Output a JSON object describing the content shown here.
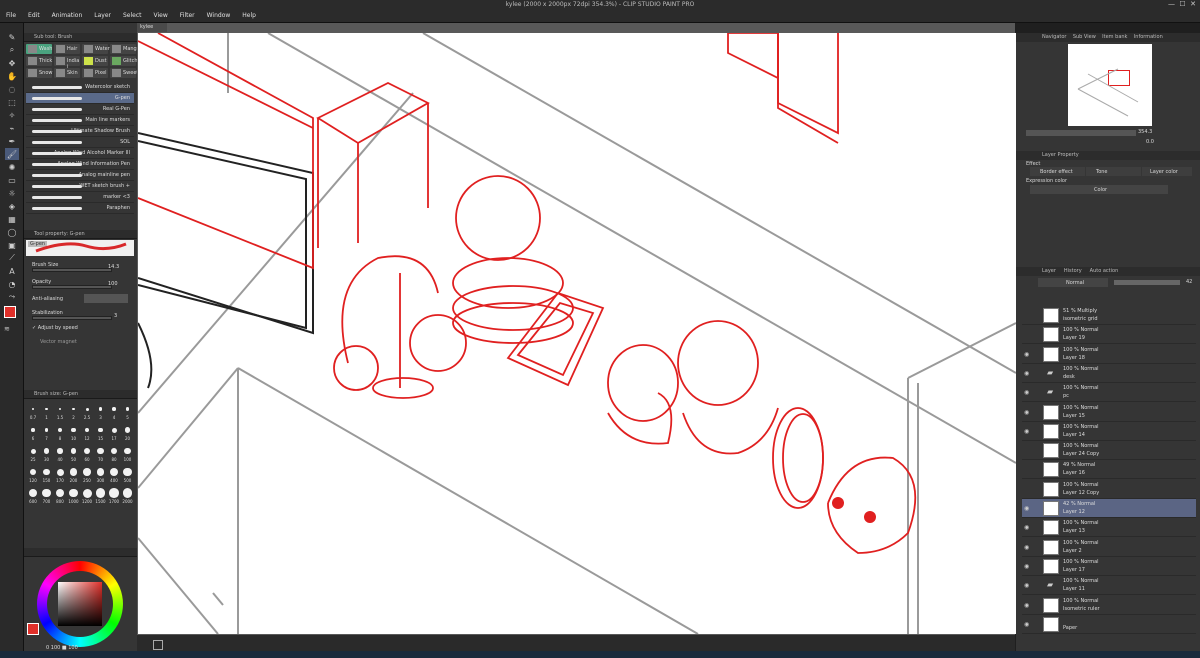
{
  "window": {
    "title": "kylee (2000 x 2000px 72dpi 354.3%) - CLIP STUDIO PAINT PRO"
  },
  "menu": [
    "File",
    "Edit",
    "Animation",
    "Layer",
    "Select",
    "View",
    "Filter",
    "Window",
    "Help"
  ],
  "canvas_tab": "kylee",
  "sub_tool": {
    "header": "Sub tool: Brush",
    "tabs": [
      "Wash",
      "Hair",
      "Water",
      "Manga",
      "Thick",
      "India i",
      "Dust",
      "Glitch",
      "Snow",
      "Skin",
      "Pixel",
      "Sweet"
    ],
    "brushes": [
      "Watercolor sketch",
      "G-pen",
      "Real G-Pen",
      "Main line markers",
      "Ultimate Shadow Brush",
      "SOL",
      "Analog Wind Alcohol Marker III",
      "Analog Wind Information Pen",
      "Analog mainline pen",
      "WET sketch brush +",
      "marker <3",
      "Paraphen"
    ],
    "selected_index": 1
  },
  "tool_property": {
    "header": "Tool property: G-pen",
    "brush_name": "G-pen",
    "brush_size_label": "Brush Size",
    "brush_size_value": "14.3",
    "opacity_label": "Opacity",
    "opacity_value": "100",
    "antialias_label": "Anti-aliasing",
    "stabilization_label": "Stabilization",
    "stabilization_value": "3",
    "adjust_label": "Adjust by speed",
    "vector_label": "Vector magnet"
  },
  "brush_size_panel": {
    "header": "Brush size: G-pen",
    "sizes": [
      "0.7",
      "1",
      "1.5",
      "2",
      "2.5",
      "3",
      "4",
      "5",
      "6",
      "7",
      "8",
      "10",
      "12",
      "15",
      "17",
      "20",
      "25",
      "30",
      "40",
      "50",
      "60",
      "70",
      "80",
      "100",
      "120",
      "150",
      "170",
      "200",
      "250",
      "300",
      "400",
      "500",
      "600",
      "700",
      "800",
      "1000",
      "1200",
      "1500",
      "1700",
      "2000"
    ]
  },
  "color_panel": {
    "main_color": "#e0302a",
    "readout": "0  100 ■ 100"
  },
  "navigator": {
    "header": "Navigator",
    "tabs": [
      "Sub View",
      "Item bank",
      "Information"
    ],
    "zoom": "354.3",
    "angle": "0.0"
  },
  "layer_property": {
    "header": "Layer Property",
    "effect_label": "Effect",
    "effects": [
      "Border effect",
      "Tone",
      "Layer color"
    ],
    "expression_label": "Expression color",
    "expression_value": "Color"
  },
  "layer_panel": {
    "tabs": [
      "Layer",
      "History",
      "Auto action"
    ],
    "blend_mode": "Normal",
    "opacity": "42",
    "layers": [
      {
        "mode": "51 % Multiply",
        "name": "isometric grid",
        "type": "layer",
        "visible": false,
        "selected": false
      },
      {
        "mode": "100 % Normal",
        "name": "Layer 19",
        "type": "layer",
        "visible": false,
        "selected": false
      },
      {
        "mode": "100 % Normal",
        "name": "Layer 18",
        "type": "layer",
        "visible": true,
        "selected": false
      },
      {
        "mode": "100 % Normal",
        "name": "desk",
        "type": "folder",
        "visible": true,
        "selected": false
      },
      {
        "mode": "100 % Normal",
        "name": "pc",
        "type": "folder",
        "visible": true,
        "selected": false
      },
      {
        "mode": "100 % Normal",
        "name": "Layer 15",
        "type": "layer",
        "visible": true,
        "selected": false
      },
      {
        "mode": "100 % Normal",
        "name": "Layer 14",
        "type": "layer",
        "visible": true,
        "selected": false
      },
      {
        "mode": "100 % Normal",
        "name": "Layer 24 Copy",
        "type": "layer",
        "visible": false,
        "selected": false
      },
      {
        "mode": "49 % Normal",
        "name": "Layer 16",
        "type": "layer",
        "visible": false,
        "selected": false
      },
      {
        "mode": "100 % Normal",
        "name": "Layer 12 Copy",
        "type": "layer",
        "visible": false,
        "selected": false
      },
      {
        "mode": "42 % Normal",
        "name": "Layer 12",
        "type": "layer",
        "visible": true,
        "selected": true
      },
      {
        "mode": "100 % Normal",
        "name": "Layer 13",
        "type": "layer",
        "visible": true,
        "selected": false
      },
      {
        "mode": "100 % Normal",
        "name": "Layer 2",
        "type": "layer",
        "visible": true,
        "selected": false
      },
      {
        "mode": "100 % Normal",
        "name": "Layer 17",
        "type": "layer",
        "visible": true,
        "selected": false
      },
      {
        "mode": "100 % Normal",
        "name": "Layer 11",
        "type": "folder",
        "visible": true,
        "selected": false
      },
      {
        "mode": "100 % Normal",
        "name": "Isometric ruler",
        "type": "layer",
        "visible": true,
        "selected": false
      },
      {
        "mode": "",
        "name": "Paper",
        "type": "layer",
        "visible": true,
        "selected": false
      }
    ]
  },
  "icons": [
    "pen-icon",
    "zoom-icon",
    "move-icon",
    "lasso-icon",
    "eyedropper-icon",
    "brush-icon",
    "eraser-icon",
    "fill-icon",
    "text-icon",
    "ruler-icon",
    "eye-icon",
    "folder-icon"
  ]
}
